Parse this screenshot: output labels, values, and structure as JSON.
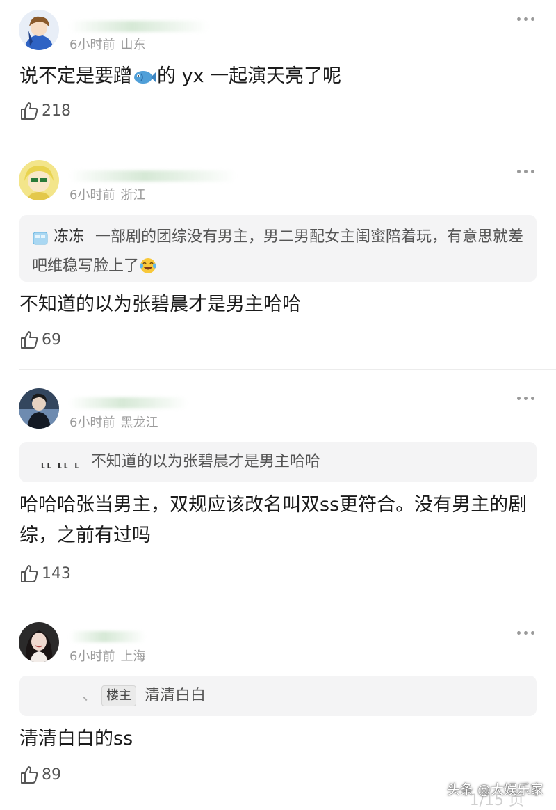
{
  "comments": [
    {
      "time": "6小时前",
      "location": "山东",
      "text_before_emoji": "说不定是要蹭",
      "text_after_emoji": "的 yx 一起演天亮了呢",
      "likes": "218",
      "avatar_icon": "anime-boy-avatar"
    },
    {
      "time": "6小时前",
      "location": "浙江",
      "quote": {
        "name": "冻冻",
        "text": "一部剧的团综没有男主，男二男配女主闺蜜陪着玩，有意思就差吧维稳写脸上了"
      },
      "text": "不知道的以为张碧晨才是男主哈哈",
      "likes": "69",
      "avatar_icon": "yellow-girl-avatar"
    },
    {
      "time": "6小时前",
      "location": "黑龙江",
      "quote": {
        "name": "⸤⸤ ⸤⸤ ⸤",
        "text": "不知道的以为张碧晨才是男主哈哈"
      },
      "text": "哈哈哈张当男主，双规应该改名叫双ss更符合。没有男主的剧综，之前有过吗",
      "likes": "143",
      "avatar_icon": "dark-figure-avatar"
    },
    {
      "time": "6小时前",
      "location": "上海",
      "quote": {
        "tag": "楼主",
        "text": "清清白白"
      },
      "text": "清清白白的ss",
      "likes": "89",
      "avatar_icon": "girl-portrait-avatar"
    }
  ],
  "watermark": {
    "text": "头条 @大娱乐家",
    "page": "1/15 页"
  },
  "colors": {
    "meta_gray": "#9a9a9a",
    "quote_bg": "#f4f4f5",
    "text": "#1a1a1a"
  }
}
